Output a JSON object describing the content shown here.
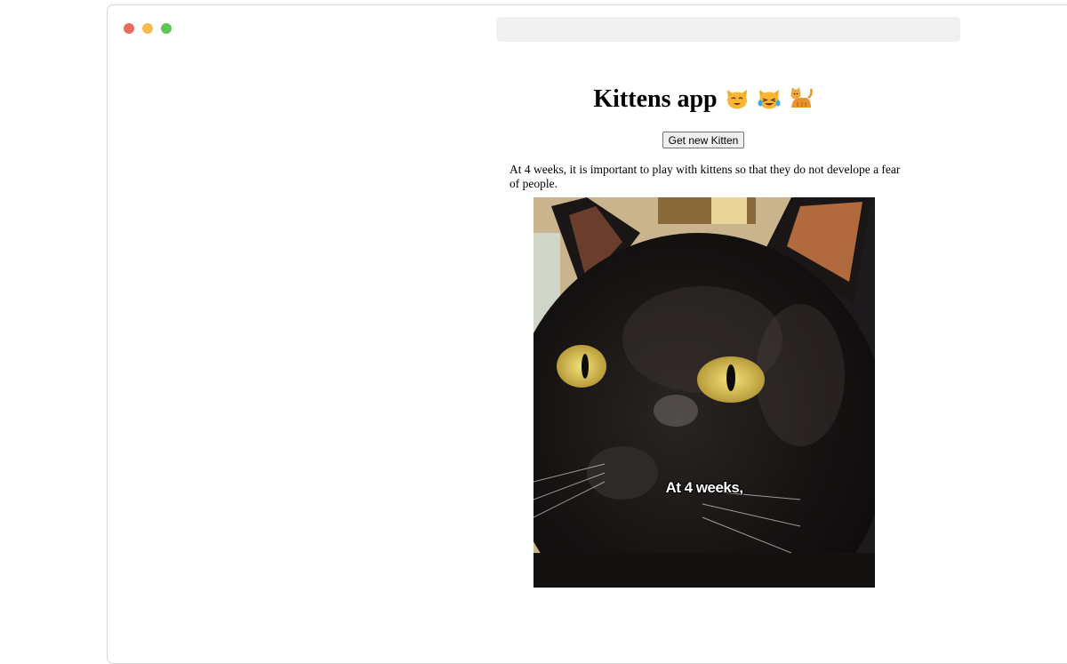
{
  "window": {
    "controls": [
      "close",
      "minimize",
      "maximize"
    ],
    "colors": {
      "close": "#ec6a5e",
      "minimize": "#f3be4f",
      "maximize": "#61c554"
    }
  },
  "page": {
    "title": "Kittens app",
    "title_icons": [
      "smiling-cat-icon",
      "cat-tears-of-joy-icon",
      "cat-icon"
    ],
    "button_label": "Get new Kitten",
    "fact_text": "At 4 weeks, it is important to play with kittens so that they do not develope a fear of people.",
    "image_caption": "At 4 weeks,"
  }
}
